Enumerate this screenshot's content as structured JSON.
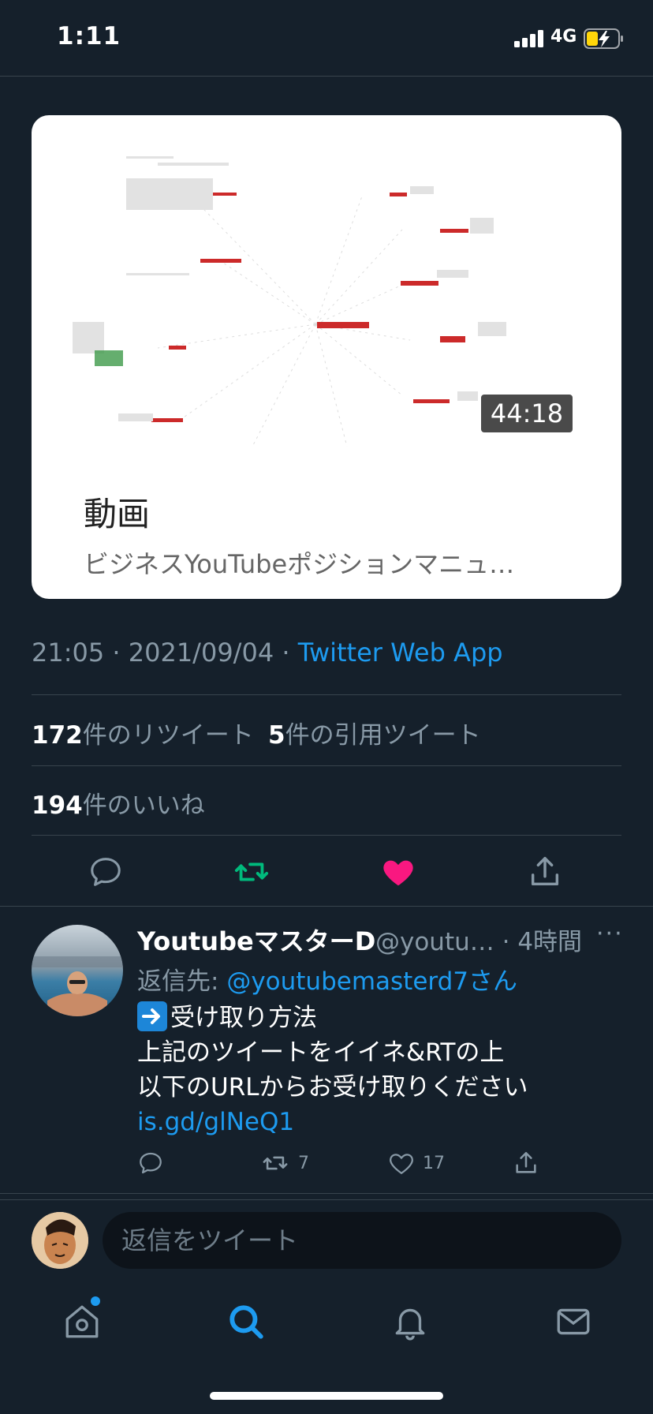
{
  "status_bar": {
    "time": "1:11",
    "network": "4G"
  },
  "media": {
    "duration": "44:18",
    "title": "動画",
    "subtitle": "ビジネスYouTubeポジションマニュ…"
  },
  "tweet": {
    "time_date": "21:05 · 2021/09/04 · ",
    "source": "Twitter Web App",
    "retweets_count": "172",
    "retweets_label": "件のリツイート",
    "quotes_count": "5",
    "quotes_label": "件の引用ツイート",
    "likes_count": "194",
    "likes_label": "件のいいね"
  },
  "reply": {
    "name": "YoutubeマスターD",
    "handle": "@youtu…",
    "time": "· 4時間",
    "more": "···",
    "reply_to_label": "返信先: ",
    "reply_to_handle": "@youtubemasterd7さん",
    "line1": "受け取り方法",
    "line2": "上記のツイートをイイネ&RTの上",
    "line3": "以下のURLからお受け取りください",
    "link": "is.gd/glNeQ1",
    "retweets": "7",
    "likes": "17"
  },
  "compose": {
    "placeholder": "返信をツイート"
  },
  "colors": {
    "accent": "#1d9bf0",
    "retweet": "#00ba7c",
    "like": "#f91880",
    "background": "#15202b"
  },
  "icons": [
    "reply-icon",
    "retweet-icon",
    "like-icon",
    "share-icon",
    "home-icon",
    "search-icon",
    "notifications-icon",
    "messages-icon"
  ]
}
